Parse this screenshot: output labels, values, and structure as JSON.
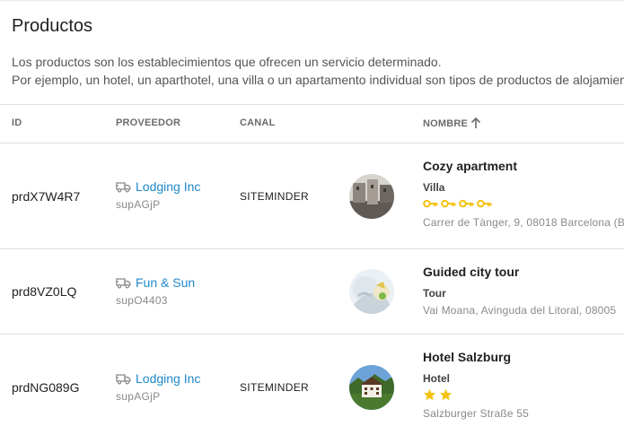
{
  "page": {
    "title": "Productos",
    "description_line1": "Los productos son los establecimientos que ofrecen un servicio determinado.",
    "description_line2": "Por ejemplo, un hotel, un aparthotel, una villa o un apartamento individual son tipos de productos de alojamiento."
  },
  "table": {
    "columns": {
      "id": "ID",
      "proveedor": "PROVEEDOR",
      "canal": "CANAL",
      "nombre": "NOMBRE"
    },
    "sort": {
      "column": "NOMBRE",
      "direction": "ascending",
      "icon": "arrow-up-icon"
    },
    "rows": [
      {
        "id": "prdX7W4R7",
        "provider_name": "Lodging Inc",
        "provider_code": "supAGjP",
        "provider_icon": "truck-icon",
        "canal": "SITEMINDER",
        "name": "Cozy apartment",
        "type": "Villa",
        "rating": {
          "kind": "keys",
          "value": 4,
          "color": "#f4c20d"
        },
        "address": "Carrer de Tànger, 9, 08018 Barcelona (B"
      },
      {
        "id": "prd8VZ0LQ",
        "provider_name": "Fun & Sun",
        "provider_code": "supO4403",
        "provider_icon": "truck-icon",
        "canal": "",
        "name": "Guided city tour",
        "type": "Tour",
        "rating": null,
        "address": "Vai Moana, Avinguda del Litoral, 08005"
      },
      {
        "id": "prdNG089G",
        "provider_name": "Lodging Inc",
        "provider_code": "supAGjP",
        "provider_icon": "truck-icon",
        "canal": "SITEMINDER",
        "name": "Hotel Salzburg",
        "type": "Hotel",
        "rating": {
          "kind": "stars",
          "value": 2,
          "color": "#f4c20d"
        },
        "address": "Salzburger Straße 55"
      }
    ]
  },
  "colors": {
    "link": "#1e88c9",
    "rating": "#f4c20d",
    "divider": "#e0e0e0"
  }
}
